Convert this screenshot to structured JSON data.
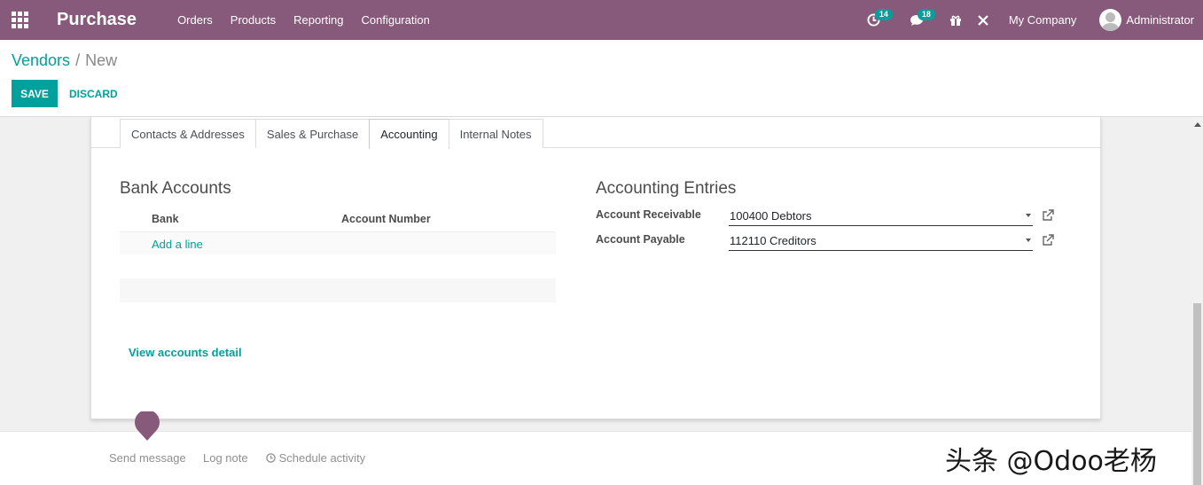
{
  "navbar": {
    "app_name": "Purchase",
    "menu": [
      "Orders",
      "Products",
      "Reporting",
      "Configuration"
    ],
    "activity_count": "14",
    "message_count": "18",
    "company": "My Company",
    "user": "Administrator",
    "accent_color": "#875a7b"
  },
  "breadcrumb": {
    "parent": "Vendors",
    "separator": "/",
    "current": "New"
  },
  "buttons": {
    "save": "SAVE",
    "discard": "DISCARD"
  },
  "tabs": [
    "Contacts & Addresses",
    "Sales & Purchase",
    "Accounting",
    "Internal Notes"
  ],
  "active_tab": "Accounting",
  "bank_accounts": {
    "title": "Bank Accounts",
    "columns": [
      "Bank",
      "Account Number"
    ],
    "add_line": "Add a line",
    "view_detail": "View accounts detail"
  },
  "accounting_entries": {
    "title": "Accounting Entries",
    "receivable_label": "Account Receivable",
    "receivable_value": "100400 Debtors",
    "payable_label": "Account Payable",
    "payable_value": "112110 Creditors"
  },
  "chatter": {
    "send_message": "Send message",
    "log_note": "Log note",
    "schedule_activity": "Schedule activity"
  },
  "watermark": "头条 @Odoo老杨",
  "colors": {
    "primary": "#00a09d",
    "brand": "#875a7b"
  }
}
